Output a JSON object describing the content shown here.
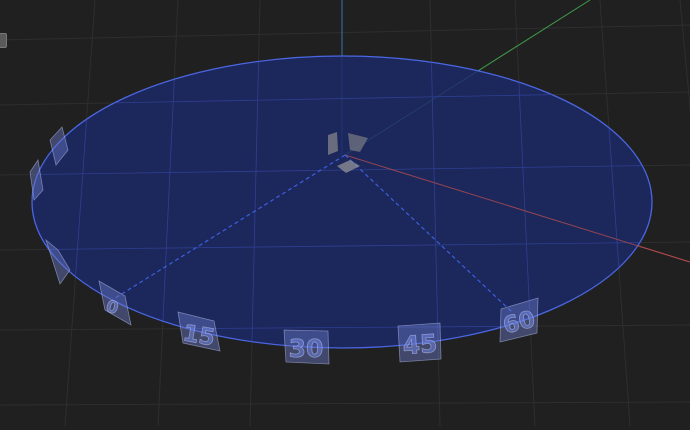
{
  "scene": {
    "background_color": "#202020",
    "grid_color": "#2f2f2f",
    "axis_colors": {
      "x": "#b04a4a",
      "y": "#3f9a4a",
      "z": "#3a6fb0"
    },
    "dial_fill": "#1c2a6a",
    "dial_edge": "#4a66e0",
    "tick_fill": "#6a7ac8",
    "tick_labels": [
      "0",
      "15",
      "30",
      "45",
      "60"
    ]
  }
}
